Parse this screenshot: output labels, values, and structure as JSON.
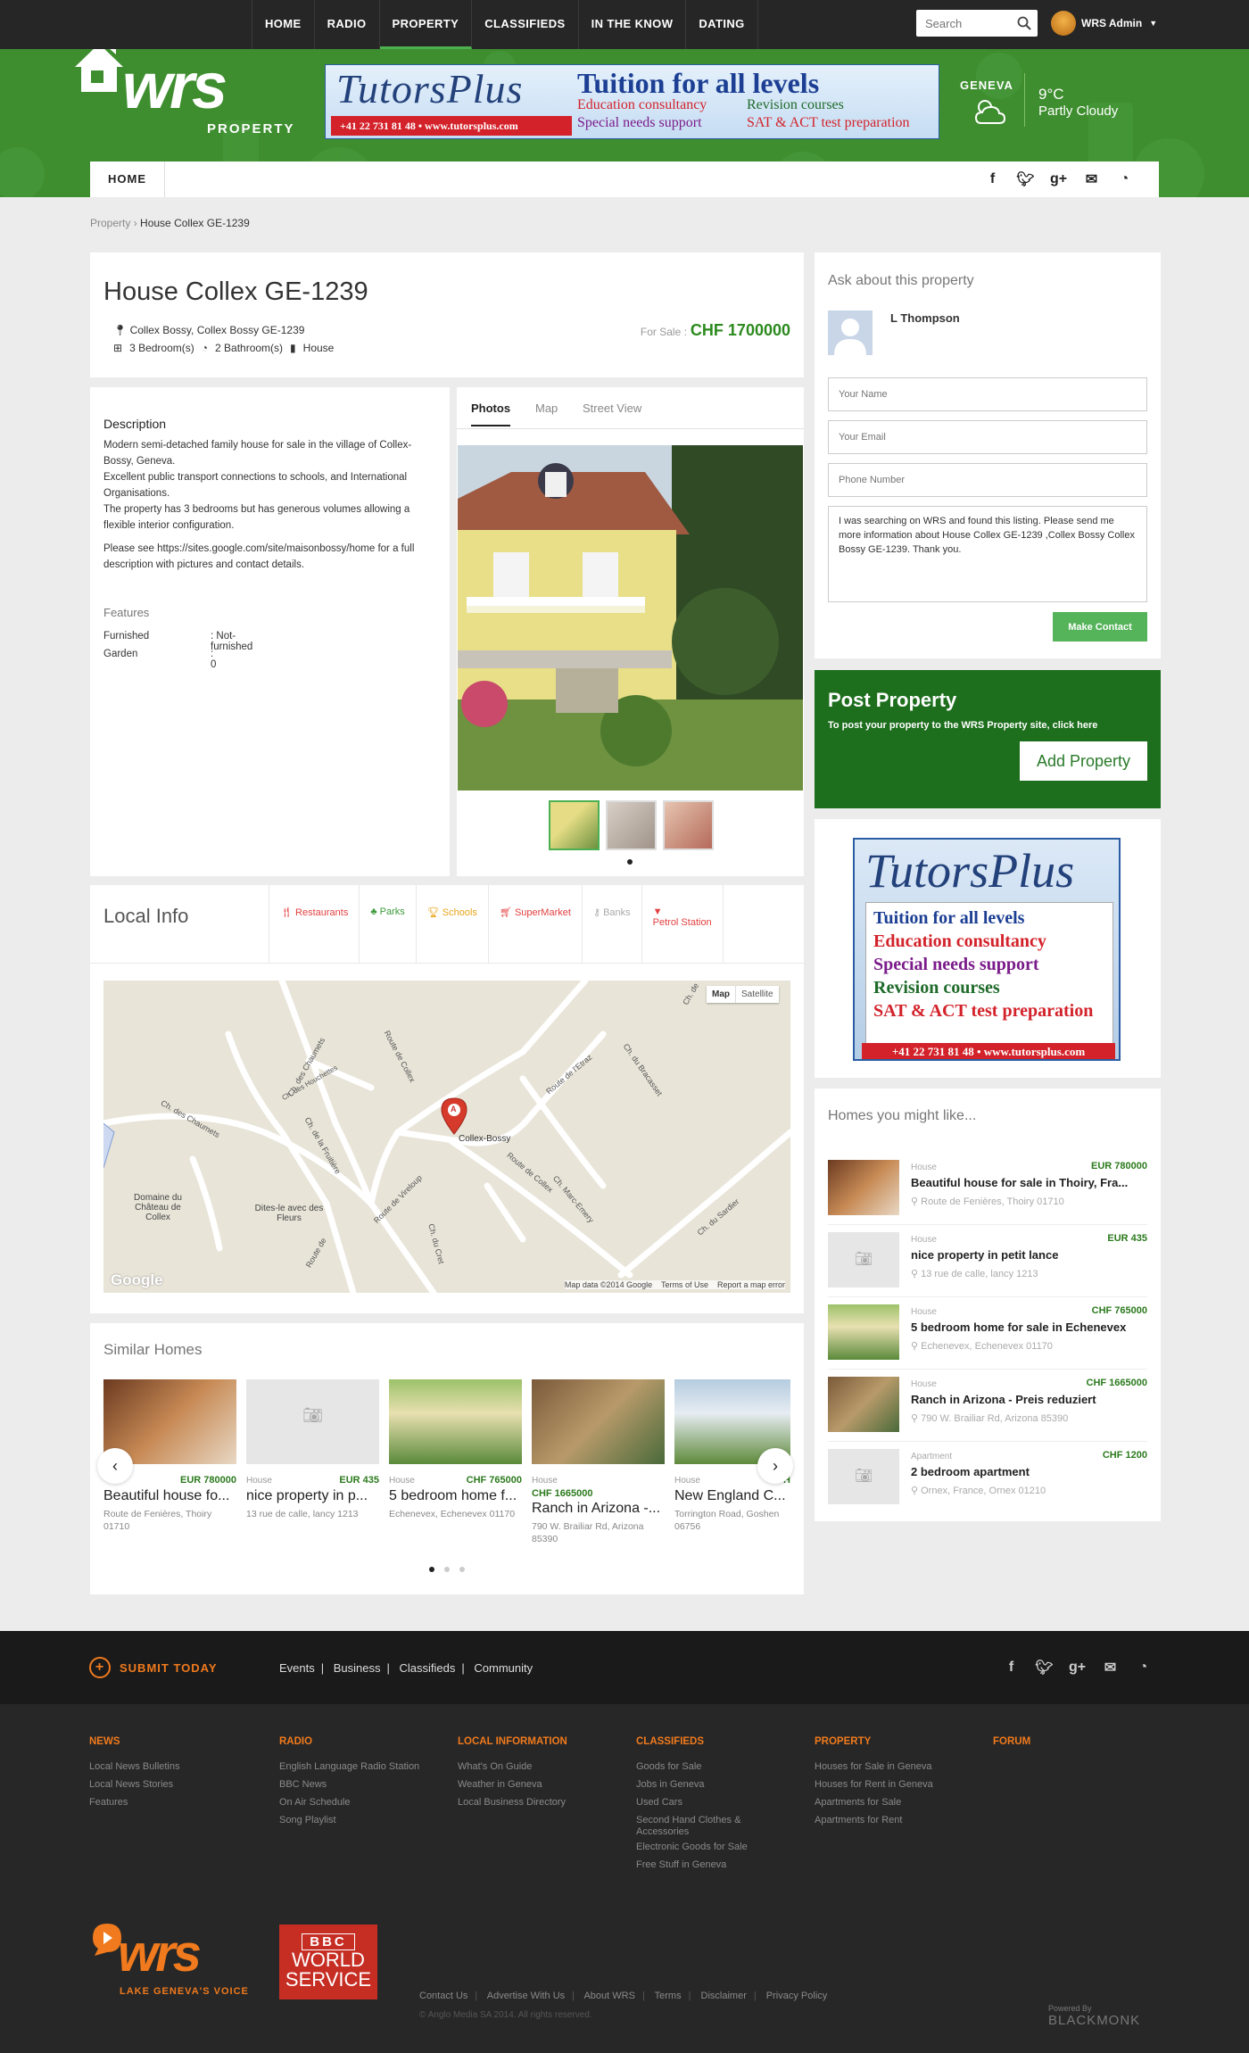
{
  "topnav": {
    "items": [
      "HOME",
      "RADIO",
      "PROPERTY",
      "CLASSIFIEDS",
      "IN THE KNOW",
      "DATING"
    ],
    "search_placeholder": "Search",
    "user": "WRS Admin"
  },
  "header": {
    "logo_text": "wrs",
    "logo_sub": "PROPERTY",
    "banner": {
      "brand": "TutorsPlus",
      "headline": "Tuition for all levels",
      "line1": "Education consultancy",
      "line2": "Special needs support",
      "line3": "Revision courses",
      "line4": "SAT & ACT test preparation",
      "phone": "+41 22 731 81 48 • www.tutorsplus.com"
    },
    "weather": {
      "city": "GENEVA",
      "temp": "9°C",
      "condition": "Partly Cloudy"
    }
  },
  "subnav": {
    "home": "HOME"
  },
  "breadcrumb": {
    "root": "Property",
    "current": "House Collex GE-1239"
  },
  "property": {
    "title": "House Collex GE-1239",
    "location": "Collex Bossy, Collex Bossy GE-1239",
    "bedrooms": "3 Bedroom(s)",
    "bathrooms": "2 Bathroom(s)",
    "type": "House",
    "price_label": "For Sale :",
    "price": "CHF 1700000"
  },
  "description": {
    "heading": "Description",
    "text1": "Modern semi-detached family house for sale in the village of Collex-Bossy, Geneva.",
    "text2": "Excellent public transport connections to schools, and International Organisations.",
    "text3": "The property has 3 bedrooms but has generous volumes allowing a flexible interior configuration.",
    "text4": "Please see https://sites.google.com/site/maisonbossy/home for a full description with pictures and contact details.",
    "features_heading": "Features",
    "features": [
      {
        "name": "Furnished",
        "value": ": Not-furnished"
      },
      {
        "name": "Garden",
        "value": ": 0"
      }
    ]
  },
  "photo_tabs": [
    "Photos",
    "Map",
    "Street View"
  ],
  "local_info": {
    "heading": "Local Info",
    "tabs": [
      "Restaurants",
      "Parks",
      "Schools",
      "SuperMarket",
      "Banks",
      "Petrol Station"
    ],
    "map": {
      "map_btn": "Map",
      "satellite_btn": "Satellite",
      "place": "Collex-Bossy",
      "marker": "A",
      "footer1": "Map data ©2014 Google",
      "footer2": "Terms of Use",
      "footer3": "Report a map error",
      "google": "Google",
      "streets": [
        "Route de Collex",
        "Ch. des Chaumets",
        "Ch. de la Fruitière",
        "Route de Vireloup",
        "Route de l'Etraz",
        "Ch. du Bracasset",
        "Ch. Marc-Emery",
        "Ch. du Sardier",
        "Route de Collex",
        "Ch. des Houchettes",
        "Ch. des Chaumets",
        "Ch. du Cret",
        "Route de",
        "Ch. de"
      ],
      "domaine": "Domaine du Château de Collex",
      "dites": "Dites-le avec des Fleurs"
    }
  },
  "similar": {
    "heading": "Similar Homes",
    "items": [
      {
        "type": "",
        "price": "EUR 780000",
        "name": "Beautiful house fo...",
        "address": "Route de Fenières, Thoiry 01710"
      },
      {
        "type": "House",
        "price": "EUR 435",
        "name": "nice property in p...",
        "address": "13 rue de calle, lancy 1213"
      },
      {
        "type": "House",
        "price": "CHF 765000",
        "name": "5 bedroom home f...",
        "address": "Echenevex, Echenevex 01170"
      },
      {
        "type": "House",
        "price": "CHF 1665000",
        "name": "Ranch in Arizona -...",
        "address": "790 W. Brailiar Rd, Arizona 85390"
      },
      {
        "type": "House",
        "price": "CH",
        "name": "New England C...",
        "address": "Torrington Road, Goshen 06756"
      }
    ]
  },
  "ask": {
    "heading": "Ask about this property",
    "agent": "L Thompson",
    "name_placeholder": "Your Name",
    "email_placeholder": "Your Email",
    "phone_placeholder": "Phone Number",
    "message": "I was searching on WRS and found this listing. Please send me more information about House Collex GE-1239 ,Collex Bossy Collex Bossy GE-1239. Thank you.",
    "button": "Make Contact"
  },
  "post": {
    "heading": "Post Property",
    "text": "To post your property to the WRS Property site, click here",
    "button": "Add Property"
  },
  "ad2": {
    "brand": "TutorsPlus",
    "l1": "Tuition for all levels",
    "l2": "Education consultancy",
    "l3": "Special needs support",
    "l4": "Revision courses",
    "l5": "SAT & ACT test preparation",
    "phone": "+41 22 731 81 48 • www.tutorsplus.com"
  },
  "homes": {
    "heading": "Homes you might like...",
    "items": [
      {
        "type": "House",
        "price": "EUR 780000",
        "name": "Beautiful house for sale in Thoiry, Fra...",
        "address": "Route de Fenières, Thoiry 01710"
      },
      {
        "type": "House",
        "price": "EUR 435",
        "name": "nice property in petit lance",
        "address": "13 rue de calle, lancy 1213"
      },
      {
        "type": "House",
        "price": "CHF 765000",
        "name": "5 bedroom home for sale in Echenevex",
        "address": "Echenevex, Echenevex 01170"
      },
      {
        "type": "House",
        "price": "CHF 1665000",
        "name": "Ranch in Arizona - Preis reduziert",
        "address": "790 W. Brailiar Rd, Arizona 85390"
      },
      {
        "type": "Apartment",
        "price": "CHF 1200",
        "name": "2 bedroom apartment",
        "address": "Ornex, France, Ornex 01210"
      }
    ]
  },
  "footer": {
    "submit": "SUBMIT TODAY",
    "links": [
      "Events",
      "Business",
      "Classifieds",
      "Community"
    ],
    "columns": [
      {
        "title": "NEWS",
        "items": [
          "Local News Bulletins",
          "Local News Stories",
          "Features"
        ]
      },
      {
        "title": "RADIO",
        "items": [
          "English Language Radio Station",
          "BBC News",
          "On Air Schedule",
          "Song Playlist"
        ]
      },
      {
        "title": "LOCAL INFORMATION",
        "items": [
          "What's On Guide",
          "Weather in Geneva",
          "Local Business Directory"
        ]
      },
      {
        "title": "CLASSIFIEDS",
        "items": [
          "Goods for Sale",
          "Jobs in Geneva",
          "Used Cars",
          "Second Hand Clothes &",
          "Accessories",
          "Electronic Goods for Sale",
          "Free Stuff in Geneva"
        ]
      },
      {
        "title": "PROPERTY",
        "items": [
          "Houses for Sale in Geneva",
          "Houses for Rent in Geneva",
          "Apartments for Sale",
          "Apartments for Rent"
        ]
      },
      {
        "title": "FORUM",
        "items": []
      }
    ],
    "logo": "wrs",
    "tagline": "LAKE GENEVA'S VOICE",
    "bbc1": "BBC",
    "bbc2": "WORLD",
    "bbc3": "SERVICE",
    "bottom_links": [
      "Contact Us",
      "Advertise With Us",
      "About WRS",
      "Terms",
      "Disclaimer",
      "Privacy Policy"
    ],
    "copyright": "© Anglo Media SA 2014. All rights reserved.",
    "powered": "Powered By",
    "blackmonk": "BLACKMONK"
  },
  "colors": {
    "brand_green": "#3e8e2f",
    "accent_orange": "#f07a1d",
    "price_green": "#2b8a1d"
  }
}
